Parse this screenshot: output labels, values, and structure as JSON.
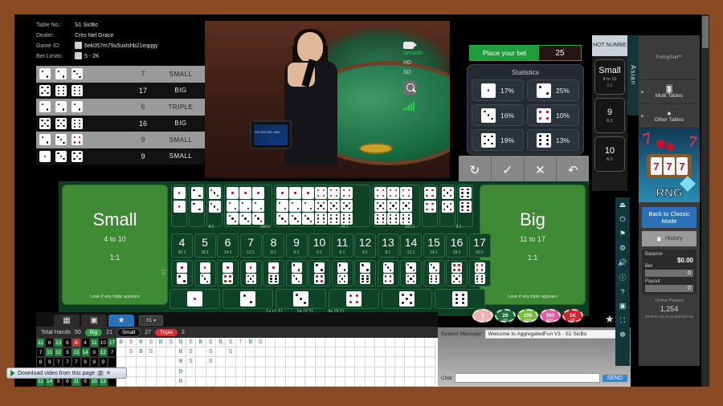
{
  "table_info": {
    "rows": [
      {
        "label": "Table No.:",
        "value": "S1 SicBo",
        "icon": null
      },
      {
        "label": "Dealer:",
        "value": "Cres Nel Grace",
        "icon": null
      },
      {
        "label": "Game ID:",
        "value": "6ek057m79u5uxlshb21eqqgy",
        "icon": "copy-icon"
      },
      {
        "label": "Bet Limits:",
        "value": "5 - 2K",
        "icon": "limits-icon"
      }
    ]
  },
  "history": [
    {
      "dice": [
        2,
        2,
        3
      ],
      "total": "7",
      "result": "SMALL"
    },
    {
      "dice": [
        5,
        6,
        6
      ],
      "total": "17",
      "result": "BIG"
    },
    {
      "dice": [
        2,
        2,
        2
      ],
      "total": "6",
      "result": "TRIPLE"
    },
    {
      "dice": [
        5,
        5,
        6
      ],
      "total": "16",
      "result": "BIG"
    },
    {
      "dice": [
        2,
        3,
        4
      ],
      "total": "9",
      "result": "SMALL"
    },
    {
      "dice": [
        1,
        3,
        5
      ],
      "total": "9",
      "result": "SMALL"
    }
  ],
  "video": {
    "quality_options": [
      "Smooth",
      "HD",
      "SD"
    ],
    "active_quality": "Smooth",
    "zoom_icon": "magnifier-icon",
    "signal_icon": "signal-bars-icon",
    "monitor_text": "+63 906 528 4455"
  },
  "bet_status": {
    "label": "Place your bet",
    "timer": "25"
  },
  "statistics": {
    "title": "Statistics",
    "cells": [
      {
        "face": 1,
        "pct": "17%"
      },
      {
        "face": 2,
        "pct": "25%"
      },
      {
        "face": 3,
        "pct": "16%"
      },
      {
        "face": 4,
        "pct": "10%"
      },
      {
        "face": 5,
        "pct": "19%"
      },
      {
        "face": 6,
        "pct": "13%"
      }
    ]
  },
  "actions": [
    {
      "name": "repeat-button",
      "glyph": "↻"
    },
    {
      "name": "confirm-button",
      "glyph": "✓"
    },
    {
      "name": "cancel-button",
      "glyph": "✕"
    },
    {
      "name": "undo-button",
      "glyph": "↶"
    }
  ],
  "board": {
    "small": {
      "title": "Small",
      "range": "4 to 10",
      "payout": "1:1",
      "note": "Lose if any triple appears"
    },
    "big": {
      "title": "Big",
      "range": "11 to 17",
      "payout": "1:1",
      "note": "Lose if any triple appears"
    },
    "triple_payout_left": "8:1",
    "triple_payout_right": "8:1",
    "any_triple_left": "150:1",
    "any_triple_right": "150:1",
    "combo_payout": "24:1",
    "side_pay_left": "5:1",
    "side_pay_right": "5:1",
    "numbers": [
      {
        "n": "4",
        "pay": "50:1"
      },
      {
        "n": "5",
        "pay": "18:1"
      },
      {
        "n": "6",
        "pay": "14:1"
      },
      {
        "n": "7",
        "pay": "12:1"
      },
      {
        "n": "8",
        "pay": "8:1"
      },
      {
        "n": "9",
        "pay": "6:1"
      },
      {
        "n": "10",
        "pay": "6:1"
      },
      {
        "n": "11",
        "pay": "6:1"
      },
      {
        "n": "12",
        "pay": "6:1"
      },
      {
        "n": "13",
        "pay": "8:1"
      },
      {
        "n": "14",
        "pay": "12:1"
      },
      {
        "n": "15",
        "pay": "14:1"
      },
      {
        "n": "16",
        "pay": "18:1"
      },
      {
        "n": "17",
        "pay": "50:1"
      }
    ],
    "single_faces": [
      1,
      2,
      3,
      4,
      5,
      6
    ],
    "multipliers": [
      "1x (1:1)",
      "2x (2:1)",
      "3x (3:1)"
    ]
  },
  "chips": [
    {
      "value": "5",
      "color": "#f0b0ae"
    },
    {
      "value": "20",
      "color": "#1f6f3a"
    },
    {
      "value": "100",
      "color": "#7bbd3a"
    },
    {
      "value": "500",
      "color": "#e45ba0"
    },
    {
      "value": "1K",
      "color": "#d0242c"
    }
  ],
  "roadmap": {
    "tabs": [
      {
        "name": "tab-bead-road",
        "icon": "grid-icon",
        "active": false
      },
      {
        "name": "tab-big-road",
        "icon": "screen-icon",
        "active": false
      },
      {
        "name": "tab-favorite",
        "icon": "star-icon",
        "active": true
      }
    ],
    "zoom_select": "X1",
    "summary": {
      "total_label": "Total Hands",
      "total_value": "50",
      "big_label": "Big",
      "big_value": "21",
      "small_label": "Small",
      "small_value": "27",
      "triple_label": "Triple",
      "triple_value": "2"
    },
    "number_grid": [
      [
        {
          "v": "11",
          "c": "g"
        },
        {
          "v": "8",
          "c": "k"
        },
        {
          "v": "13",
          "c": "g"
        },
        {
          "v": "6",
          "c": "k"
        },
        {
          "v": "6",
          "c": "r"
        },
        {
          "v": "4",
          "c": "k"
        },
        {
          "v": "11",
          "c": "g"
        },
        {
          "v": "10",
          "c": "k"
        },
        {
          "v": "17",
          "c": "g"
        }
      ],
      [
        {
          "v": "7",
          "c": "k"
        },
        {
          "v": "11",
          "c": "g"
        },
        {
          "v": "12",
          "c": "g"
        },
        {
          "v": "9",
          "c": "k"
        },
        {
          "v": "13",
          "c": "g"
        },
        {
          "v": "14",
          "c": "g"
        },
        {
          "v": "9",
          "c": "k"
        },
        {
          "v": "12",
          "c": "g"
        },
        {
          "v": "7",
          "c": "k"
        }
      ],
      [
        {
          "v": "8",
          "c": "k"
        },
        {
          "v": "9",
          "c": "k"
        },
        {
          "v": "7",
          "c": "k"
        },
        {
          "v": "7",
          "c": "k"
        },
        {
          "v": "7",
          "c": "k"
        },
        {
          "v": "9",
          "c": "k"
        },
        {
          "v": "9",
          "c": "k"
        },
        {
          "v": "9",
          "c": "k"
        },
        {
          "v": "",
          "c": "k"
        }
      ],
      [
        {
          "v": "11",
          "c": "g"
        },
        {
          "v": "14",
          "c": "g"
        },
        {
          "v": "8",
          "c": "k"
        },
        {
          "v": "14",
          "c": "g"
        },
        {
          "v": "12",
          "c": "g"
        },
        {
          "v": "8",
          "c": "k"
        },
        {
          "v": "5",
          "c": "k"
        },
        {
          "v": "9",
          "c": "k"
        },
        {
          "v": "",
          "c": "k"
        }
      ],
      [
        {
          "v": "11",
          "c": "g"
        },
        {
          "v": "14",
          "c": "g"
        },
        {
          "v": "8",
          "c": "k"
        },
        {
          "v": "6",
          "c": "k"
        },
        {
          "v": "11",
          "c": "g"
        },
        {
          "v": "9",
          "c": "k"
        },
        {
          "v": "15",
          "c": "g"
        },
        {
          "v": "13",
          "c": "g"
        },
        {
          "v": "",
          "c": "k"
        }
      ],
      [
        {
          "v": "9",
          "c": "k"
        },
        {
          "v": "11",
          "c": "g"
        },
        {
          "v": "13",
          "c": "g"
        },
        {
          "v": "4",
          "c": "k"
        },
        {
          "v": "10",
          "c": "k"
        },
        {
          "v": "11",
          "c": "g"
        },
        {
          "v": "10",
          "c": "k"
        },
        {
          "v": "6",
          "c": "r"
        },
        {
          "v": "",
          "c": "k"
        }
      ]
    ],
    "bs_grid": [
      [
        "B",
        "S",
        "B",
        "S",
        "B",
        "S",
        "B",
        "S",
        "B",
        "S",
        "B",
        "S",
        "T",
        "B",
        "S"
      ],
      [
        "",
        "S",
        "B",
        "S",
        "",
        "",
        "B",
        "S",
        "",
        "S",
        "",
        "S",
        "",
        "",
        ""
      ],
      [
        "",
        "",
        "",
        "",
        "",
        "",
        "B",
        "S",
        "",
        "S",
        "",
        "",
        "",
        "",
        ""
      ],
      [
        "",
        "",
        "",
        "",
        "",
        "",
        "B",
        "",
        "",
        "",
        "",
        "",
        "",
        "",
        ""
      ],
      [
        "",
        "",
        "",
        "",
        "",
        "",
        "B",
        "",
        "",
        "",
        "",
        "",
        "",
        "",
        ""
      ]
    ]
  },
  "chat": {
    "system_label": "System Message:",
    "system_value": "Welcome to AggregatedFun V3 - S1 SicBo",
    "chat_label": "Chat",
    "chat_value": "",
    "send_label": "SEND"
  },
  "hot_numbers": {
    "title": "HOT NUMBE",
    "cells": [
      {
        "t1": "Small",
        "t2": "4 to 10",
        "t3": "1:1"
      },
      {
        "t1": "9",
        "t2": "6:1",
        "t3": ""
      },
      {
        "t1": "10",
        "t2": "6:1",
        "t3": ""
      }
    ]
  },
  "side_tab": {
    "label": "Asian"
  },
  "right_panel": {
    "username": "FunnySun**",
    "items": [
      {
        "label": "Multi Tables",
        "icon": "cards-icon"
      },
      {
        "label": "Other Tables",
        "icon": "table-icon"
      }
    ],
    "promo": {
      "text": "RNG",
      "reels": [
        "7",
        "7",
        "7"
      ]
    },
    "classic_mode": "Back to Classic Mode",
    "history_label": "History",
    "history_icon": "clipboard-icon",
    "balance_label": "Balance",
    "balance_value": "$0.00",
    "bet_label": "Bet",
    "bet_value": "0",
    "payout_label": "Payout",
    "payout_value": "0",
    "players_label": "Online Players",
    "players_value": "1,254",
    "players_time": "2019-07-18 15:44:58(GMT+8)"
  },
  "icon_strip": [
    {
      "name": "exit-icon",
      "glyph": "⏏"
    },
    {
      "name": "power-icon",
      "glyph": "⏻"
    },
    {
      "name": "bookmark-icon",
      "glyph": "⚑"
    },
    {
      "name": "gear-icon",
      "glyph": "⚙"
    },
    {
      "name": "volume-icon",
      "glyph": "🔊"
    },
    {
      "name": "info-icon",
      "glyph": "ⓘ"
    },
    {
      "name": "help-icon",
      "glyph": "?"
    },
    {
      "name": "image-icon",
      "glyph": "▣"
    },
    {
      "name": "fullscreen-icon",
      "glyph": "⛶"
    },
    {
      "name": "settings-icon",
      "glyph": "☸"
    }
  ],
  "download_bar": {
    "text": "Download video from this page",
    "count": "2",
    "close": "✕"
  }
}
